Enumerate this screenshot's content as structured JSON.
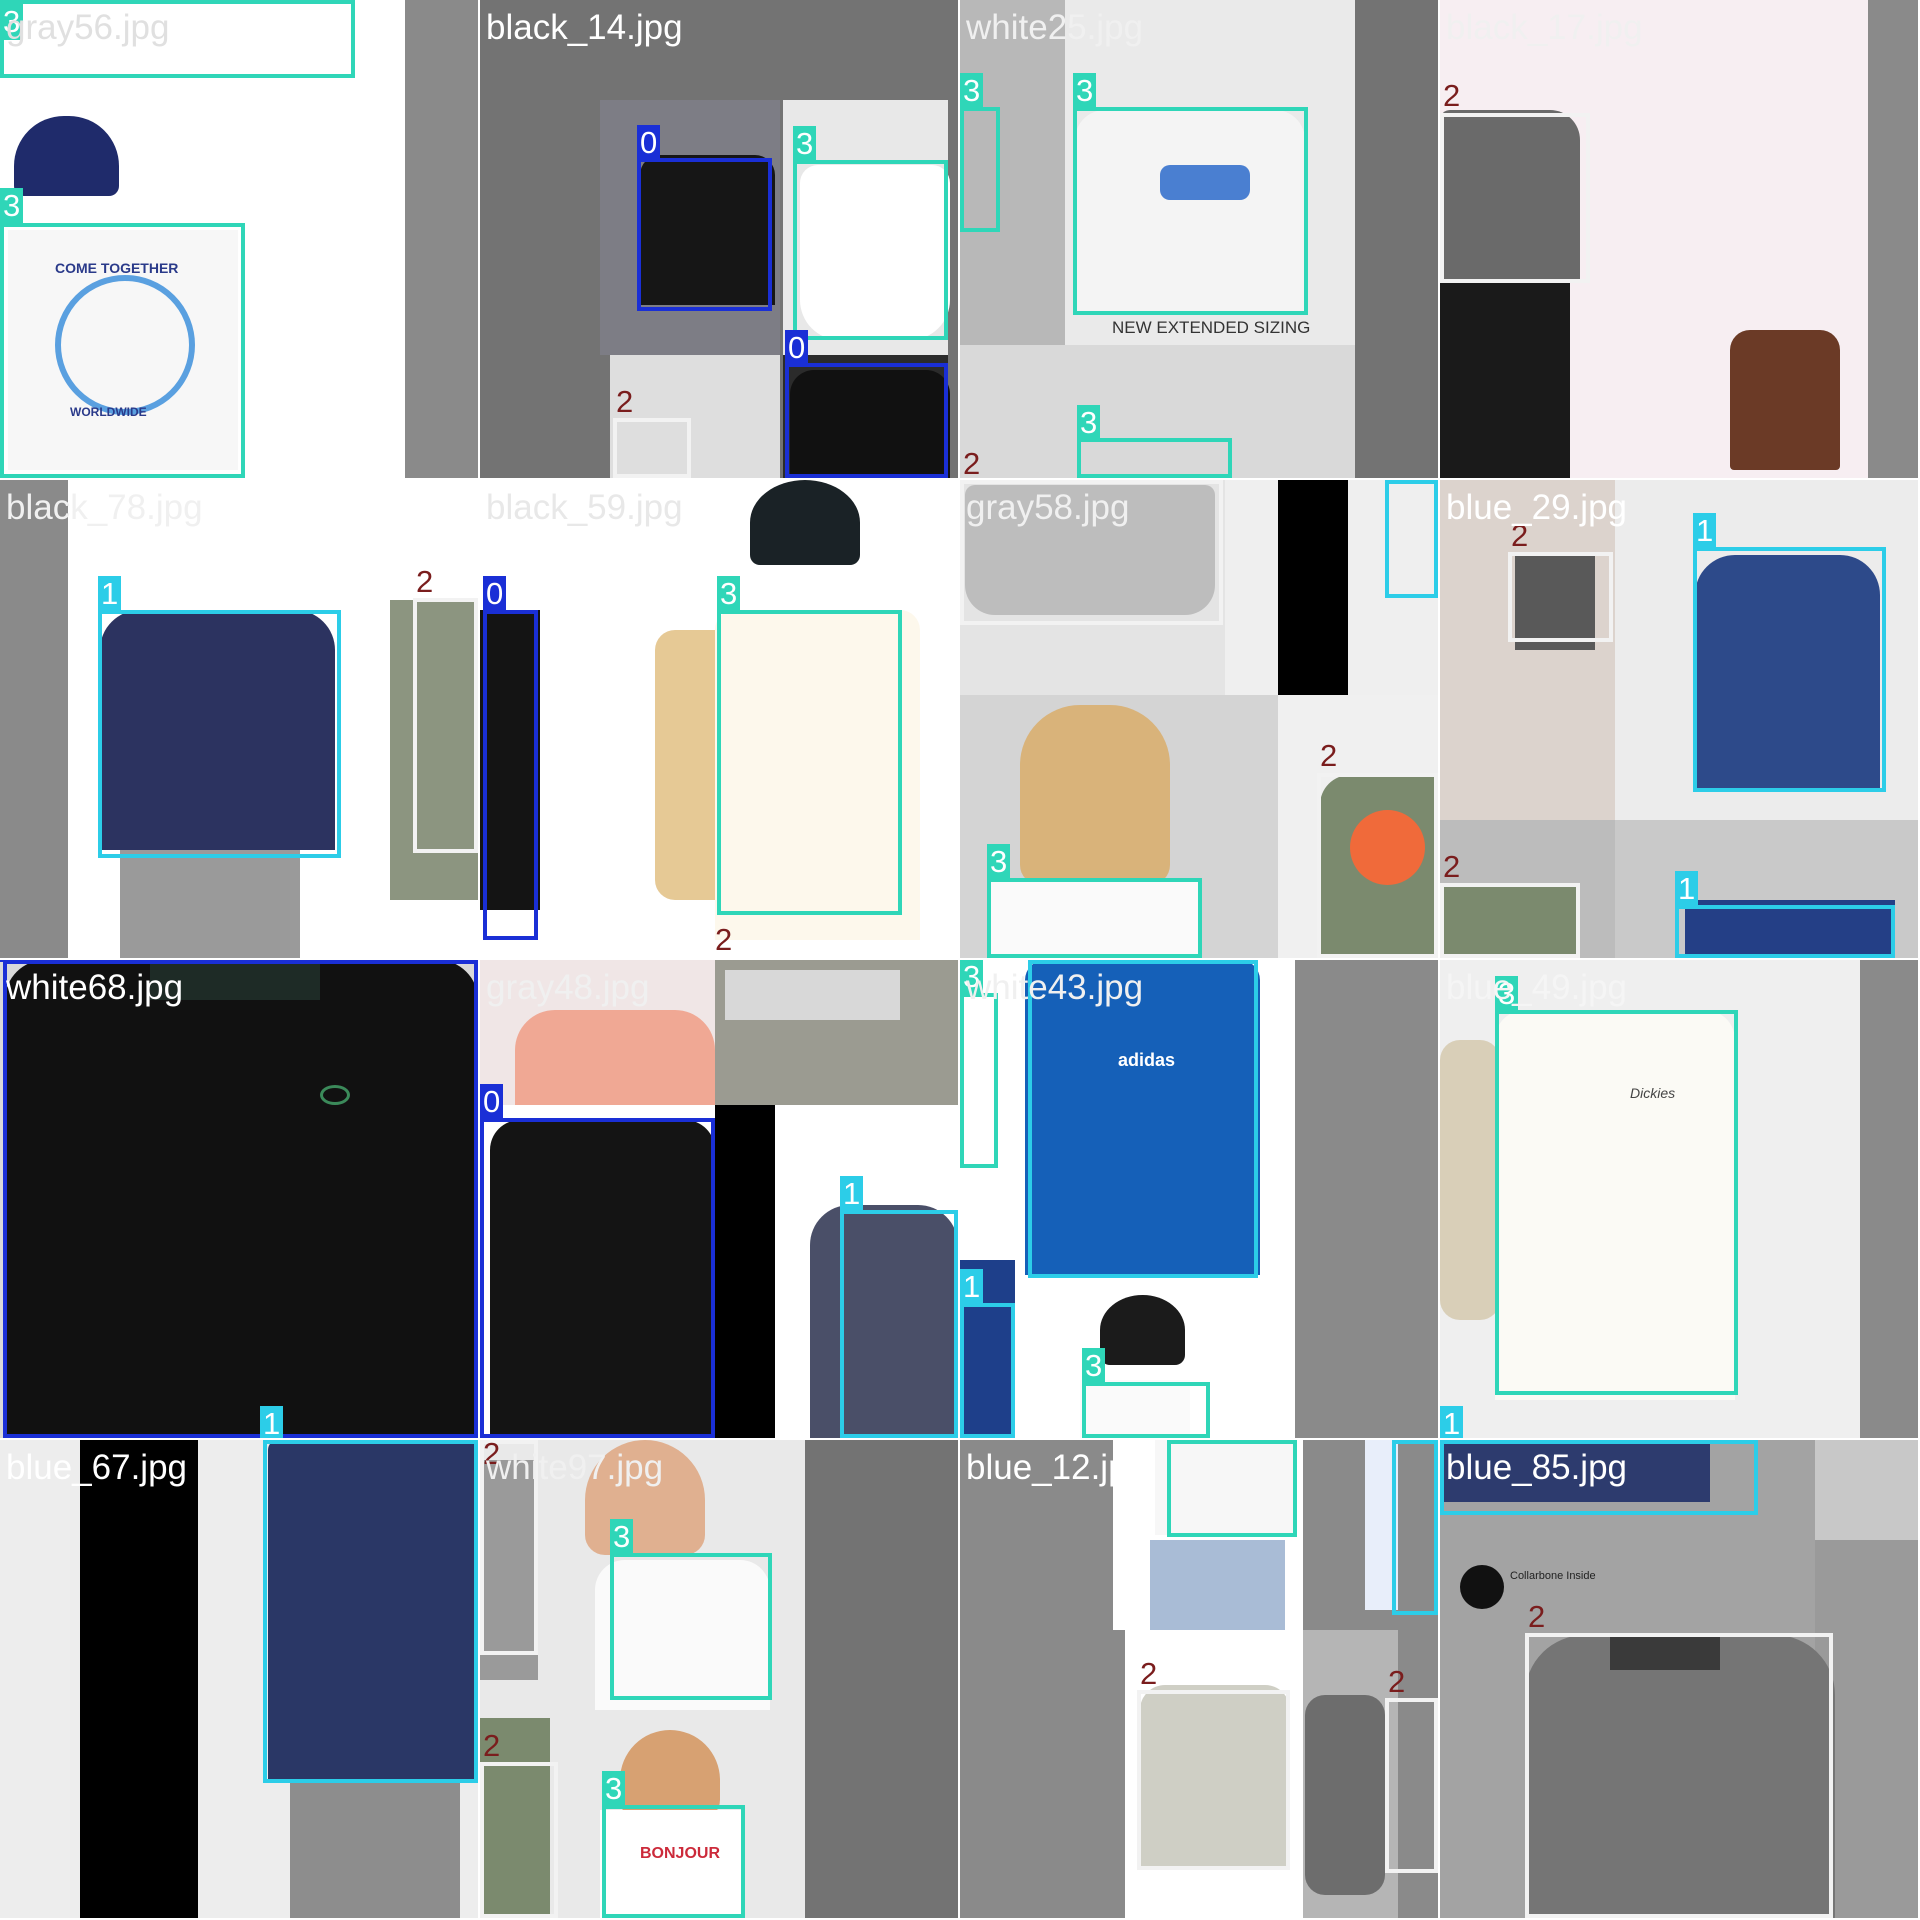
{
  "title": "",
  "colors": {
    "class_0": "#1a2fd6",
    "class_1": "#2ccde8",
    "class_2": "#f2f2f2",
    "class_3": "#2fd6b8",
    "plain_label": "#7a1d1d",
    "panel_gray": "#8a8a8a",
    "panel_dark": "#737373"
  },
  "class_ids": [
    "0",
    "1",
    "2",
    "3"
  ],
  "tiles": [
    {
      "filename": "gray56.jpg",
      "name_color": "#e0e0e0"
    },
    {
      "filename": "black_14.jpg",
      "name_color": "#ffffff"
    },
    {
      "filename": "white25.jpg",
      "name_color": "#f0f0f0"
    },
    {
      "filename": "black_17.jpg",
      "name_color": "#f0f0f0"
    },
    {
      "filename": "black_78.jpg",
      "name_color": "#f0f0f0"
    },
    {
      "filename": "black_59.jpg",
      "name_color": "#e8e8e8"
    },
    {
      "filename": "gray58.jpg",
      "name_color": "#f0f0f0"
    },
    {
      "filename": "blue_29.jpg",
      "name_color": "#ffffff"
    },
    {
      "filename": "white68.jpg",
      "name_color": "#ffffff"
    },
    {
      "filename": "gray48.jpg",
      "name_color": "#f0f0f0"
    },
    {
      "filename": "white43.jpg",
      "name_color": "#f0f0f0"
    },
    {
      "filename": "blue_49.jpg",
      "name_color": "#f5f5f5"
    },
    {
      "filename": "blue_67.jpg",
      "name_color": "#ffffff"
    },
    {
      "filename": "white97.jpg",
      "name_color": "#f0f0f0"
    },
    {
      "filename": "blue_12.jpg",
      "name_color": "#ffffff"
    },
    {
      "filename": "blue_85.jpg",
      "name_color": "#ffffff"
    }
  ],
  "shirt_texts": {
    "come_together": "COME TOGETHER",
    "worldwide": "WORLDWIDE",
    "extended_sizing": "NEW EXTENDED SIZING",
    "adidas": "adidas",
    "dickies": "Dickies",
    "bonjour": "BONJOUR",
    "collarbone": "Collarbone Inside"
  }
}
